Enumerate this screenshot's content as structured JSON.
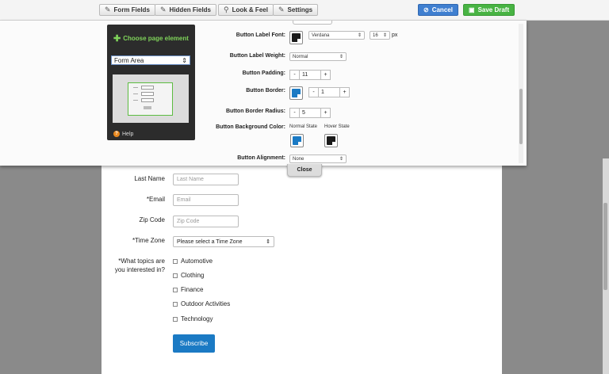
{
  "toolbar": {
    "form_fields": "Form Fields",
    "hidden_fields": "Hidden Fields",
    "look_feel": "Look & Feel",
    "settings": "Settings",
    "cancel": "Cancel",
    "save_draft": "Save Draft"
  },
  "sidebar": {
    "title": "Choose page element",
    "selected_element": "Form Area",
    "help": "Help"
  },
  "settings": {
    "label_font": {
      "label": "Button Label Font:",
      "font": "Verdana",
      "size": "16",
      "unit": "px",
      "color": "#1a1a1a"
    },
    "label_weight": {
      "label": "Button Label Weight:",
      "value": "Normal"
    },
    "padding": {
      "label": "Button Padding:",
      "value": "11",
      "minus": "-",
      "plus": "+"
    },
    "border": {
      "label": "Button Border:",
      "value": "1",
      "color": "#1b7ac4",
      "minus": "-",
      "plus": "+"
    },
    "border_radius": {
      "label": "Button Border Radius:",
      "value": "5",
      "minus": "-",
      "plus": "+"
    },
    "background": {
      "label": "Button Background Color:",
      "normal_state": "Normal State",
      "hover_state": "Hover State",
      "normal_color": "#1b7ac4",
      "hover_color": "#1a1a1a"
    },
    "alignment": {
      "label": "Button Alignment:",
      "value": "None"
    }
  },
  "close_label": "Close",
  "form": {
    "fields": [
      {
        "label": "Last Name",
        "placeholder": "Last Name"
      },
      {
        "label": "*Email",
        "placeholder": "Email"
      },
      {
        "label": "Zip Code",
        "placeholder": "Zip Code"
      }
    ],
    "timezone": {
      "label": "*Time Zone",
      "value": "Please select a Time Zone"
    },
    "topics": {
      "label_line1": "*What topics are",
      "label_line2": "you interested in?",
      "options": [
        "Automotive",
        "Clothing",
        "Finance",
        "Outdoor Activities",
        "Technology"
      ]
    },
    "submit": "Subscribe"
  }
}
